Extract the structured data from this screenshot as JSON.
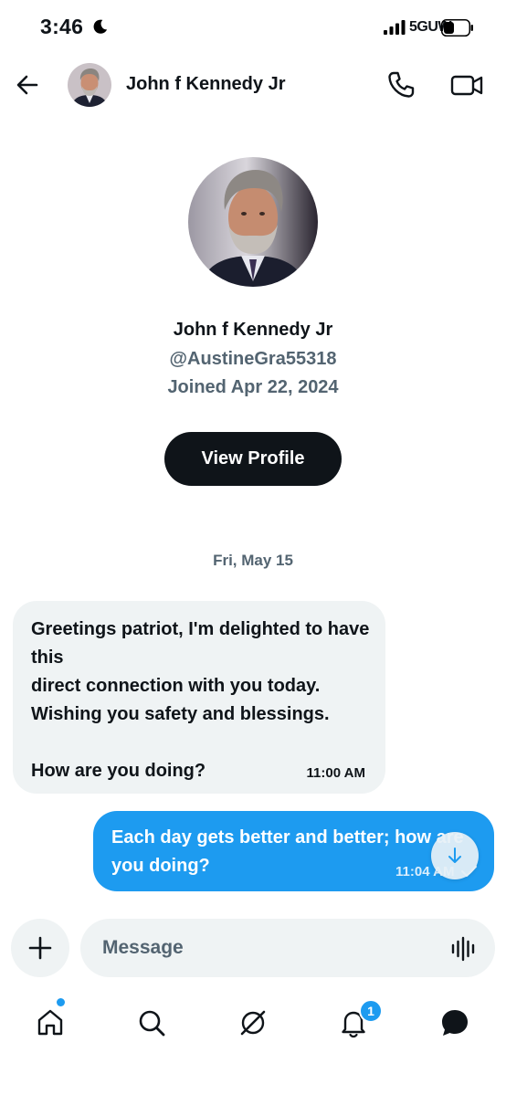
{
  "status_bar": {
    "time": "3:46",
    "network": "5GUW"
  },
  "header": {
    "name": "John f Kennedy Jr"
  },
  "profile": {
    "name": "John f Kennedy Jr",
    "handle": "@AustineGra55318",
    "joined": "Joined Apr 22, 2024",
    "view_profile_label": "View Profile"
  },
  "conversation": {
    "date_separator": "Fri, May 15",
    "messages": [
      {
        "direction": "incoming",
        "text": "Greetings patriot, I'm delighted to have this\ndirect connection with you today.\nWishing you safety and blessings.\n\nHow are you doing?",
        "time": "11:00 AM"
      },
      {
        "direction": "outgoing",
        "text": "Each day gets better and better; how are you doing?",
        "time": "11:04 AM"
      }
    ]
  },
  "composer": {
    "placeholder": "Message"
  },
  "bottom_nav": {
    "notifications_badge": "1"
  },
  "colors": {
    "accent": "#1d9bf0",
    "dark_button": "#0f1419",
    "muted_text": "#536471",
    "incoming_bubble": "#eff3f4"
  }
}
